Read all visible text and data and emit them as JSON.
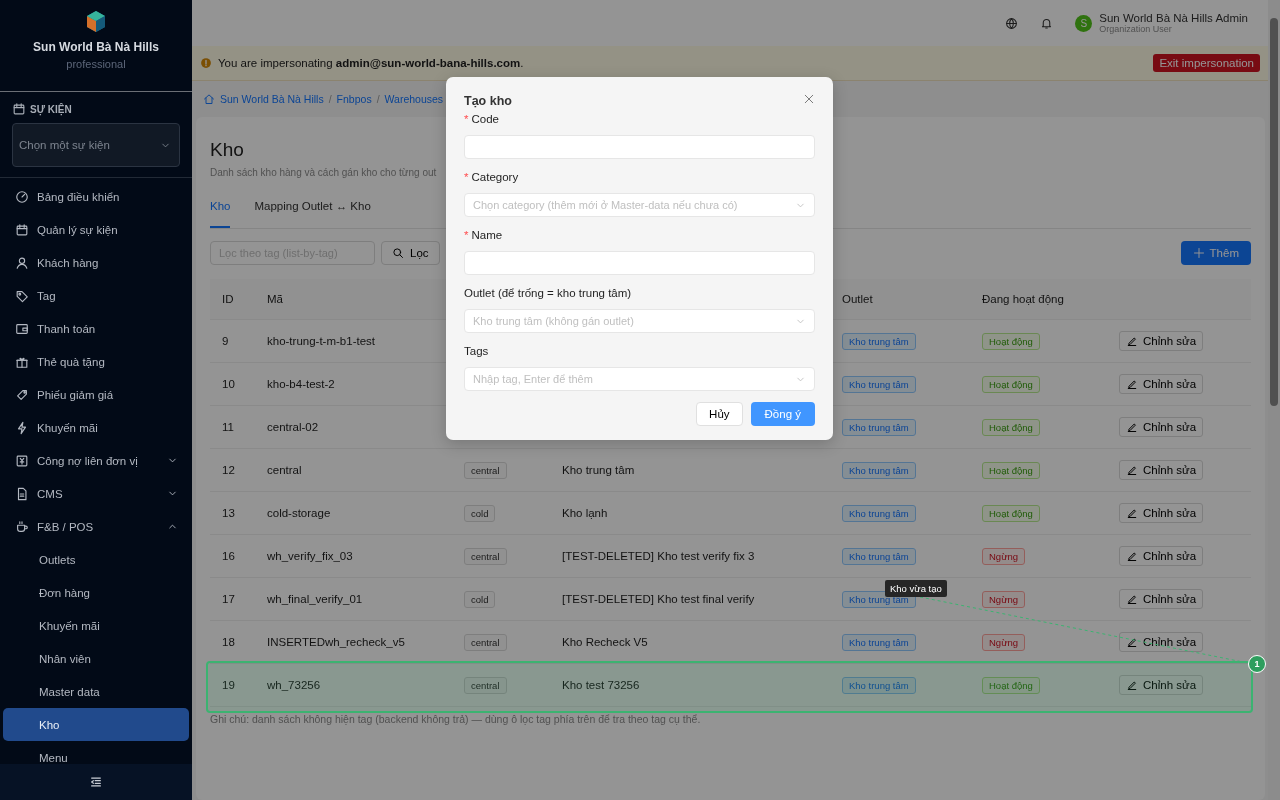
{
  "sidebar": {
    "org_name": "Sun World Bà Nà Hills",
    "org_plan": "professional",
    "section_label": "SỰ KIỆN",
    "event_select": {
      "placeholder": "Chọn một sự kiện"
    },
    "items": [
      {
        "label": "Bảng điều khiển",
        "kind": "link",
        "selected": false
      },
      {
        "label": "Quản lý sự kiện",
        "kind": "link",
        "selected": false
      },
      {
        "label": "Khách hàng",
        "kind": "link",
        "selected": false
      },
      {
        "label": "Tag",
        "kind": "link",
        "selected": false
      },
      {
        "label": "Thanh toán",
        "kind": "link",
        "selected": false
      },
      {
        "label": "Thẻ quà tặng",
        "kind": "link",
        "selected": false
      },
      {
        "label": "Phiếu giảm giá",
        "kind": "link",
        "selected": false
      },
      {
        "label": "Khuyến mãi",
        "kind": "link",
        "selected": false
      },
      {
        "label": "Công nợ liên đơn vị",
        "kind": "group",
        "expanded": false,
        "selected": false
      },
      {
        "label": "CMS",
        "kind": "group",
        "expanded": false,
        "selected": false
      },
      {
        "label": "F&B / POS",
        "kind": "group",
        "expanded": true,
        "selected": false,
        "children": [
          {
            "label": "Outlets",
            "selected": false
          },
          {
            "label": "Đơn hàng",
            "selected": false
          },
          {
            "label": "Khuyến mãi",
            "selected": false
          },
          {
            "label": "Nhân viên",
            "selected": false
          },
          {
            "label": "Master data",
            "selected": false
          },
          {
            "label": "Kho",
            "selected": true
          },
          {
            "label": "Menu",
            "selected": false
          }
        ]
      }
    ]
  },
  "topbar": {
    "user_initial": "S",
    "user_name": "Sun World Bà Nà Hills Admin",
    "user_role": "Organization User"
  },
  "banner": {
    "text": "You are impersonating **admin@sun-world-bana-hills.com**.",
    "button": "Exit impersonation"
  },
  "breadcrumb": [
    "Sun World Bà Nà Hills",
    "Fnbpos",
    "Warehouses"
  ],
  "breadcrumb_separator": "/",
  "page": {
    "title": "Kho",
    "subtitle": "Danh sách kho hàng và cách gán kho cho từng out",
    "tabs": [
      {
        "label": "Kho",
        "selected": true
      },
      {
        "label": "Mapping Outlet ↔ Kho",
        "selected": false
      }
    ],
    "filter": {
      "placeholder": "Lọc theo tag (list-by-tag)",
      "button": "Lọc"
    },
    "add_button": "Thêm",
    "table": {
      "columns": {
        "id": "ID",
        "code": "Mã",
        "outlet": "Outlet",
        "active": "Đang hoạt động"
      },
      "rows": [
        {
          "id": "9",
          "code": "kho-trung-t-m-b1-test",
          "outlet": "Kho trung tâm",
          "status": "Hoạt động",
          "active": true,
          "action": "Chỉnh sửa",
          "highlighted": false
        },
        {
          "id": "10",
          "code": "kho-b4-test-2",
          "outlet": "Kho trung tâm",
          "status": "Hoạt động",
          "active": true,
          "action": "Chỉnh sửa",
          "highlighted": false
        },
        {
          "id": "11",
          "code": "central-02",
          "outlet": "Kho trung tâm",
          "status": "Hoạt động",
          "active": true,
          "action": "Chỉnh sửa",
          "highlighted": false
        },
        {
          "id": "12",
          "code": "central",
          "category": "central",
          "name": "Kho trung tâm",
          "outlet": "Kho trung tâm",
          "status": "Hoạt động",
          "active": true,
          "action": "Chỉnh sửa",
          "highlighted": false
        },
        {
          "id": "13",
          "code": "cold-storage",
          "category": "cold",
          "name": "Kho lạnh",
          "outlet": "Kho trung tâm",
          "status": "Hoạt động",
          "active": true,
          "action": "Chỉnh sửa",
          "highlighted": false
        },
        {
          "id": "16",
          "code": "wh_verify_fix_03",
          "category": "central",
          "name": "[TEST-DELETED] Kho test verify fix 3",
          "outlet": "Kho trung tâm",
          "status": "Ngừng",
          "active": false,
          "action": "Chỉnh sửa",
          "highlighted": false
        },
        {
          "id": "17",
          "code": "wh_final_verify_01",
          "category": "cold",
          "name": "[TEST-DELETED] Kho test final verify",
          "outlet": "Kho trung tâm",
          "status": "Ngừng",
          "active": false,
          "action": "Chỉnh sửa",
          "highlighted": false
        },
        {
          "id": "18",
          "code": "INSERTEDwh_recheck_v5",
          "category": "central",
          "name": "Kho Recheck V5",
          "outlet": "Kho trung tâm",
          "status": "Ngừng",
          "active": false,
          "action": "Chỉnh sửa",
          "highlighted": false
        },
        {
          "id": "19",
          "code": "wh_73256",
          "category": "central",
          "name": "Kho test 73256",
          "outlet": "Kho trung tâm",
          "status": "Hoạt động",
          "active": true,
          "action": "Chỉnh sửa",
          "highlighted": true
        }
      ]
    },
    "note": "Ghi chú: danh sách không hiện tag (backend không trả) — dùng ô lọc tag phía trên để tra theo tag cụ thể."
  },
  "annotation": {
    "label": "Kho vừa tạo",
    "badge": "1"
  },
  "modal": {
    "title": "Tạo kho",
    "required_mark": "*",
    "fields": [
      {
        "label": "Code",
        "kind": "text",
        "required": true
      },
      {
        "label": "Category",
        "kind": "select",
        "required": true,
        "placeholder": "Chọn category (thêm mới ở Master-data nếu chưa có)"
      },
      {
        "label": "Name",
        "kind": "text",
        "required": true
      },
      {
        "label": "Outlet (để trống = kho trung tâm)",
        "kind": "select",
        "required": false,
        "placeholder": "Kho trung tâm (không gán outlet)"
      },
      {
        "label": "Tags",
        "kind": "select",
        "required": false,
        "placeholder": "Nhập tag, Enter để thêm"
      }
    ],
    "cancel": "Hủy",
    "ok": "Đồng ý"
  }
}
